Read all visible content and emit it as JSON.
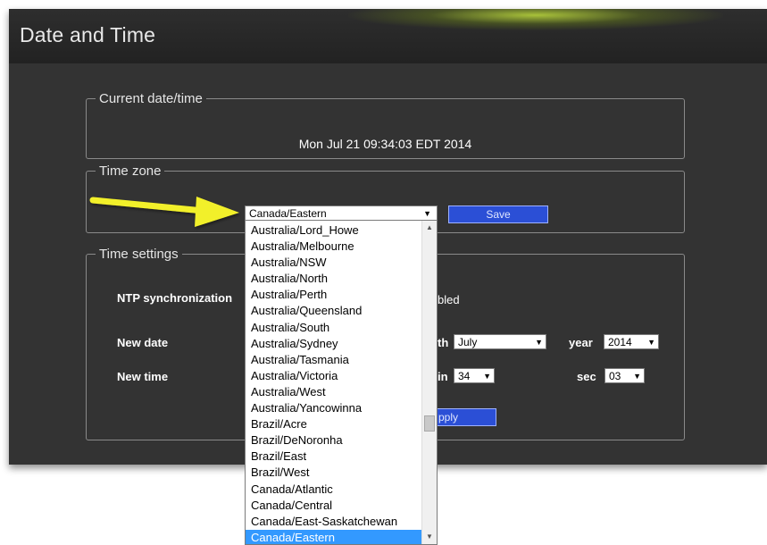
{
  "page": {
    "title": "Date and Time"
  },
  "current": {
    "legend": "Current date/time",
    "value": "Mon Jul 21 09:34:03 EDT 2014"
  },
  "timezone": {
    "legend": "Time zone",
    "selected": "Canada/Eastern",
    "save_label": "Save",
    "options": [
      "Australia/Lord_Howe",
      "Australia/Melbourne",
      "Australia/NSW",
      "Australia/North",
      "Australia/Perth",
      "Australia/Queensland",
      "Australia/South",
      "Australia/Sydney",
      "Australia/Tasmania",
      "Australia/Victoria",
      "Australia/West",
      "Australia/Yancowinna",
      "Brazil/Acre",
      "Brazil/DeNoronha",
      "Brazil/East",
      "Brazil/West",
      "Canada/Atlantic",
      "Canada/Central",
      "Canada/East-Saskatchewan",
      "Canada/Eastern"
    ]
  },
  "settings": {
    "legend": "Time settings",
    "ntp_label": "NTP synchronization",
    "ntp_value_visible": "bled",
    "new_date_label": "New date",
    "month_label_visible": "th",
    "month_value": "July",
    "year_label": "year",
    "year_value": "2014",
    "new_time_label": "New time",
    "min_label_visible": "in",
    "min_value": "34",
    "sec_label": "sec",
    "sec_value": "03",
    "apply_label_visible": "pply"
  },
  "colors": {
    "panel": "#333333",
    "button": "#2b4fd6",
    "selection": "#3399ff",
    "annotation_arrow": "#f2f02a"
  },
  "icons": {
    "dropdown": "triangle-down",
    "annotation": "arrow-right"
  }
}
